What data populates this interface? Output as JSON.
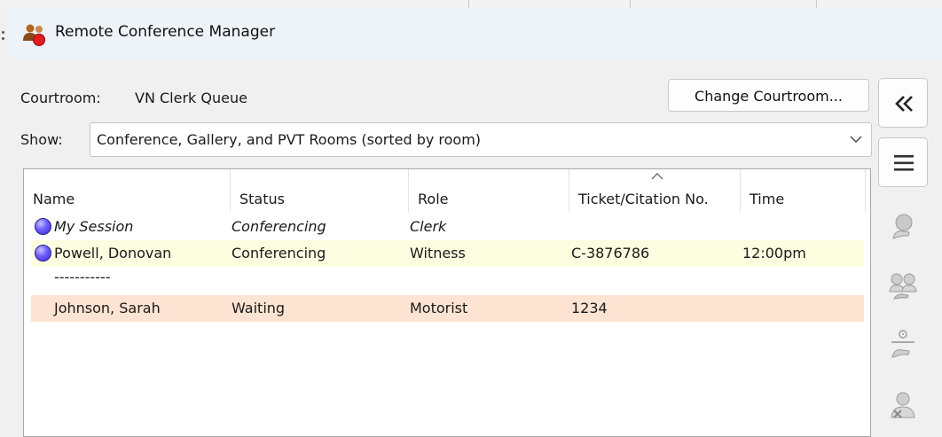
{
  "window": {
    "title": "Remote Conference Manager"
  },
  "courtroom": {
    "label": "Courtroom:",
    "value": "VN Clerk Queue",
    "change_button": "Change Courtroom..."
  },
  "show": {
    "label": "Show:",
    "selected": "Conference, Gallery, and PVT Rooms (sorted by room)"
  },
  "table": {
    "columns": [
      "Name",
      "Status",
      "Role",
      "Ticket/Citation No.",
      "Time"
    ],
    "rows": [
      {
        "name": "My Session",
        "status": "Conferencing",
        "role": "Clerk",
        "ticket": "",
        "time": ""
      },
      {
        "name": "Powell, Donovan",
        "status": "Conferencing",
        "role": "Witness",
        "ticket": "C-3876786",
        "time": "12:00pm"
      },
      {
        "name": "-----------",
        "status": "",
        "role": "",
        "ticket": "",
        "time": ""
      },
      {
        "name": "Johnson, Sarah",
        "status": "Waiting",
        "role": "Motorist",
        "ticket": "1234",
        "time": ""
      }
    ]
  },
  "colors": {
    "highlight_yellow": "#fdfde0",
    "highlight_peach": "#fde4d2",
    "bullet": "#5b4cf0"
  },
  "icons": {
    "app": "conference-people-icon",
    "collapse": "double-chevron-left-icon",
    "menu": "hamburger-menu-icon",
    "person_action": "person-hand-icon",
    "group": "group-people-icon",
    "transfer": "person-transfer-icon",
    "remove": "person-remove-icon"
  }
}
